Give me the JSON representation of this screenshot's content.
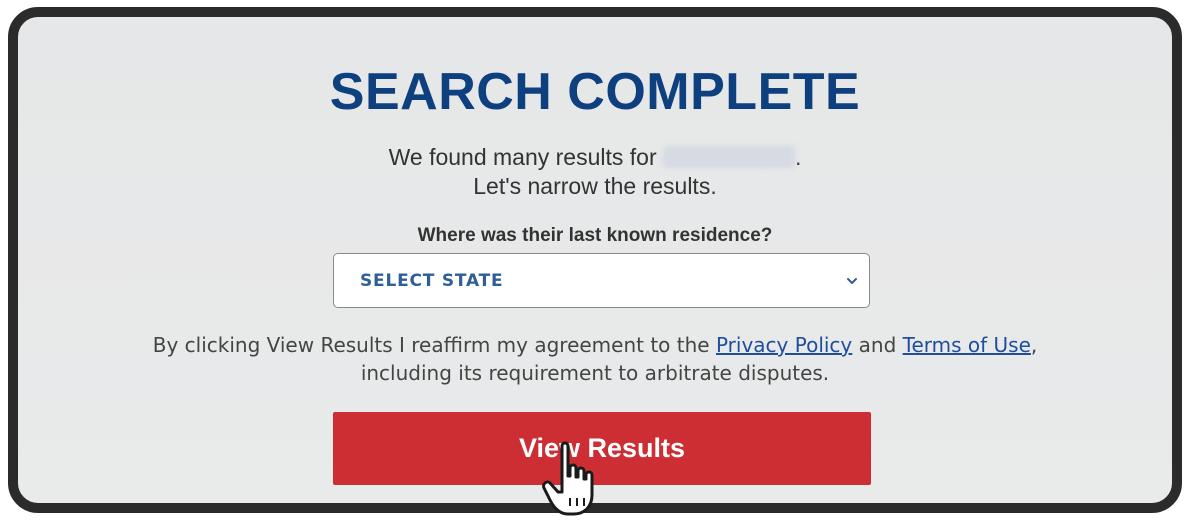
{
  "header": {
    "title": "SEARCH COMPLETE"
  },
  "message": {
    "line1_prefix": "We found many results for ",
    "line1_suffix": ".",
    "line2": "Let's narrow the results."
  },
  "question": {
    "label": "Where was their last known residence?"
  },
  "state_select": {
    "selected_label": "SELECT STATE",
    "icon": "chevron-down-icon"
  },
  "agreement": {
    "text_before": "By clicking View Results I reaffirm my agreement to the ",
    "privacy_link": "Privacy Policy",
    "text_and": " and ",
    "terms_link": "Terms of Use",
    "text_after_line1": ",",
    "text_line2": "including its requirement to arbitrate disputes."
  },
  "actions": {
    "view_results_label": "View Results"
  },
  "colors": {
    "title": "#0e3f7e",
    "button": "#cc2e33",
    "link": "#1f4e9b",
    "select_text": "#2f5f95"
  },
  "cursor": {
    "icon": "hand-pointer-icon"
  }
}
